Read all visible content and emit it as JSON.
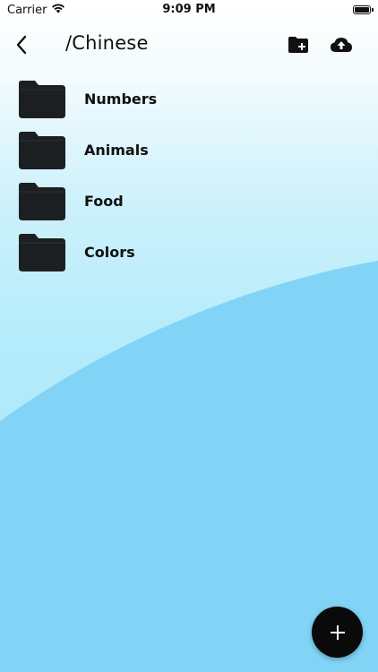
{
  "status_bar": {
    "carrier": "Carrier",
    "time": "9:09 PM",
    "battery_level": 1.0
  },
  "nav": {
    "back_icon": "chevron-left-icon",
    "title": "/Chinese",
    "new_folder_icon": "folder-plus-icon",
    "upload_icon": "cloud-upload-icon"
  },
  "folders": [
    {
      "label": "Numbers",
      "icon": "folder-icon"
    },
    {
      "label": "Animals",
      "icon": "folder-icon"
    },
    {
      "label": "Food",
      "icon": "folder-icon"
    },
    {
      "label": "Colors",
      "icon": "folder-icon"
    }
  ],
  "fab": {
    "icon": "plus-icon"
  },
  "colors": {
    "wave": "#82d4f7",
    "folder": "#1c1f22",
    "fab": "#0a0a0a"
  }
}
